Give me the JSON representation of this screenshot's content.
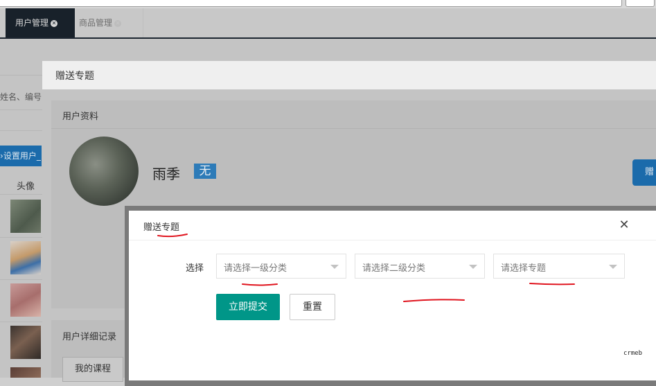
{
  "tabs": [
    {
      "label": "用户管理",
      "active": true
    },
    {
      "label": "商品管理",
      "active": false
    }
  ],
  "background_page": {
    "search_hint": "姓名、编号",
    "set_user_button": "设置用户_",
    "avatar_column": "头像"
  },
  "gift_modal": {
    "title": "赠送专题",
    "profile_card_title": "用户资料",
    "user_name": "雨季",
    "user_badge": "无",
    "gift_button": "赠",
    "detail_card_title": "用户详细记录",
    "my_courses_tab": "我的课程"
  },
  "select_modal": {
    "title": "赠送专题",
    "select_label": "选择",
    "level1_placeholder": "请选择一级分类",
    "level2_placeholder": "请选择二级分类",
    "topic_placeholder": "请选择专题",
    "submit_label": "立即提交",
    "reset_label": "重置"
  },
  "watermark": "crmeb",
  "colors": {
    "submit": "#009688",
    "primary_blue": "#1b6bab",
    "annotation_red": "#e0141e",
    "tab_active_bg": "#18212a"
  }
}
